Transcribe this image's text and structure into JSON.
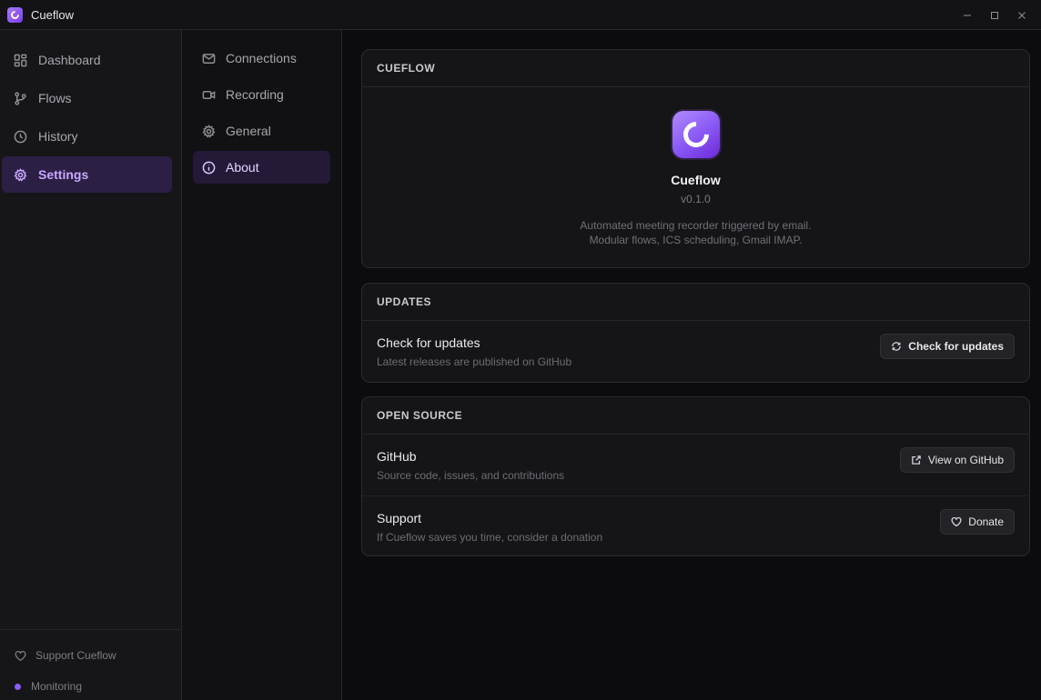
{
  "window": {
    "title": "Cueflow",
    "controls": [
      "minimize-icon",
      "maximize-icon",
      "close-icon"
    ]
  },
  "sidebar": {
    "items": [
      {
        "label": "Dashboard",
        "icon": "dashboard-icon"
      },
      {
        "label": "Flows",
        "icon": "flows-icon"
      },
      {
        "label": "History",
        "icon": "clock-icon"
      },
      {
        "label": "Settings",
        "icon": "gear-icon",
        "active": true
      }
    ],
    "footer": {
      "support_label": "Support Cueflow",
      "status_label": "Monitoring"
    }
  },
  "settings_nav": {
    "items": [
      {
        "label": "Connections",
        "icon": "mail-icon"
      },
      {
        "label": "Recording",
        "icon": "video-icon"
      },
      {
        "label": "General",
        "icon": "gear-icon"
      },
      {
        "label": "About",
        "icon": "info-icon",
        "active": true
      }
    ]
  },
  "about": {
    "header": "CUEFLOW",
    "app_name": "Cueflow",
    "version": "v0.1.0",
    "description_line1": "Automated meeting recorder triggered by email.",
    "description_line2": "Modular flows, ICS scheduling, Gmail IMAP."
  },
  "updates": {
    "header": "UPDATES",
    "title": "Check for updates",
    "subtitle": "Latest releases are published on GitHub",
    "button": "Check for updates"
  },
  "open_source": {
    "header": "OPEN SOURCE",
    "github_title": "GitHub",
    "github_subtitle": "Source code, issues, and contributions",
    "github_button": "View on GitHub",
    "support_title": "Support",
    "support_subtitle": "If Cueflow saves you time, consider a donation",
    "support_button": "Donate"
  },
  "colors": {
    "accent": "#8b5cf6",
    "accent_text": "#c8a8ff",
    "background": "#0c0c0e",
    "card": "#151518"
  }
}
